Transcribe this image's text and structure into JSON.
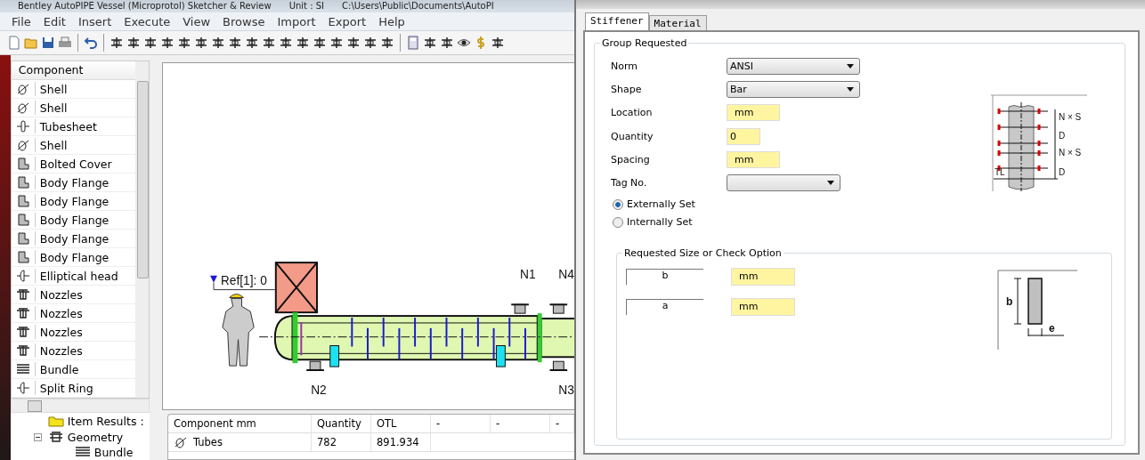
{
  "window": {
    "title": "Bentley AutoPIPE Vessel (Microprotol) Sketcher & Review",
    "unit": "Unit : SI",
    "path": "C:\\Users\\Public\\Documents\\AutoPI"
  },
  "menu": [
    "File",
    "Edit",
    "Insert",
    "Execute",
    "View",
    "Browse",
    "Import",
    "Export",
    "Help"
  ],
  "component_list": {
    "header": "Component",
    "items": [
      {
        "label": "Shell",
        "kind": "shell"
      },
      {
        "label": "Shell",
        "kind": "shell"
      },
      {
        "label": "Tubesheet",
        "kind": "tubesheet"
      },
      {
        "label": "Shell",
        "kind": "shell"
      },
      {
        "label": "Bolted Cover",
        "kind": "flange"
      },
      {
        "label": "Body Flange",
        "kind": "flange"
      },
      {
        "label": "Body Flange",
        "kind": "flange"
      },
      {
        "label": "Body Flange",
        "kind": "flange"
      },
      {
        "label": "Body Flange",
        "kind": "flange"
      },
      {
        "label": "Body Flange",
        "kind": "flange"
      },
      {
        "label": "Elliptical head",
        "kind": "head"
      },
      {
        "label": "Nozzles",
        "kind": "nozzle"
      },
      {
        "label": "Nozzles",
        "kind": "nozzle"
      },
      {
        "label": "Nozzles",
        "kind": "nozzle"
      },
      {
        "label": "Nozzles",
        "kind": "nozzle"
      },
      {
        "label": "Bundle",
        "kind": "bundle"
      },
      {
        "label": "Split Ring",
        "kind": "head"
      }
    ]
  },
  "tree": [
    {
      "label": "Item Results :",
      "kind": "folder"
    },
    {
      "label": "Geometry",
      "kind": "geometry",
      "expanded": true,
      "children": [
        {
          "label": "Bundle",
          "kind": "bundle"
        }
      ]
    }
  ],
  "sketch": {
    "reference": "Ref[1]: 0",
    "nozzles": [
      "N1",
      "N4",
      "N2",
      "N3"
    ]
  },
  "results_table": {
    "columns": [
      "Component mm",
      "Quantity",
      "OTL",
      "-",
      "-",
      "-"
    ],
    "rows": [
      {
        "cells": [
          "Tubes",
          "782",
          "891.934"
        ]
      }
    ]
  },
  "dialog": {
    "tabs": [
      {
        "label": "Stiffener",
        "selected": true
      },
      {
        "label": "Material",
        "selected": false
      }
    ],
    "group": {
      "title": "Group Requested",
      "fields": [
        {
          "label": "Norm",
          "kind": "select",
          "value": "ANSI"
        },
        {
          "label": "Shape",
          "kind": "select",
          "value": "Bar"
        },
        {
          "label": "Location",
          "kind": "input",
          "value": "mm"
        },
        {
          "label": "Quantity",
          "kind": "input",
          "value": "0"
        },
        {
          "label": "Spacing",
          "kind": "input",
          "value": "mm"
        },
        {
          "label": "Tag No.",
          "kind": "select"
        }
      ],
      "diagram_labels": [
        "N × S",
        "D",
        "N × S",
        "TL",
        "D"
      ],
      "options": [
        {
          "label": "Externally Set",
          "selected": true
        },
        {
          "label": "Internally Set",
          "selected": false
        }
      ]
    },
    "size_group": {
      "title": "Requested Size or Check Option",
      "fields": [
        {
          "label": "b",
          "value": "mm"
        },
        {
          "label": "a",
          "value": "mm"
        }
      ],
      "diagram_labels": [
        "b",
        "e"
      ]
    }
  }
}
